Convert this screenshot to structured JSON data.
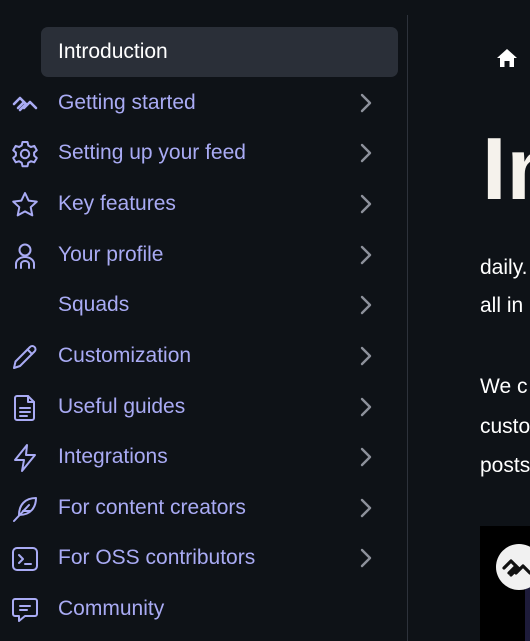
{
  "sidebar": {
    "items": [
      {
        "label": "Introduction",
        "icon": "none",
        "active": true
      },
      {
        "label": "Getting started",
        "icon": "daily-logo-icon"
      },
      {
        "label": "Setting up your feed",
        "icon": "gear-icon"
      },
      {
        "label": "Key features",
        "icon": "star-icon"
      },
      {
        "label": "Your profile",
        "icon": "user-icon"
      },
      {
        "label": "Squads",
        "icon": "none"
      },
      {
        "label": "Customization",
        "icon": "pencil-icon"
      },
      {
        "label": "Useful guides",
        "icon": "document-icon"
      },
      {
        "label": "Integrations",
        "icon": "lightning-icon"
      },
      {
        "label": "For content creators",
        "icon": "feather-icon"
      },
      {
        "label": "For OSS contributors",
        "icon": "terminal-icon"
      },
      {
        "label": "Community",
        "icon": "chat-icon"
      }
    ]
  },
  "main": {
    "title_partial": "In",
    "para1": [
      "daily.",
      "all in"
    ],
    "para2": [
      "We c",
      "custo",
      "posts"
    ]
  },
  "colors": {
    "background": "#0e1217",
    "link": "#a9abf4",
    "active_bg": "#2a2f38"
  }
}
